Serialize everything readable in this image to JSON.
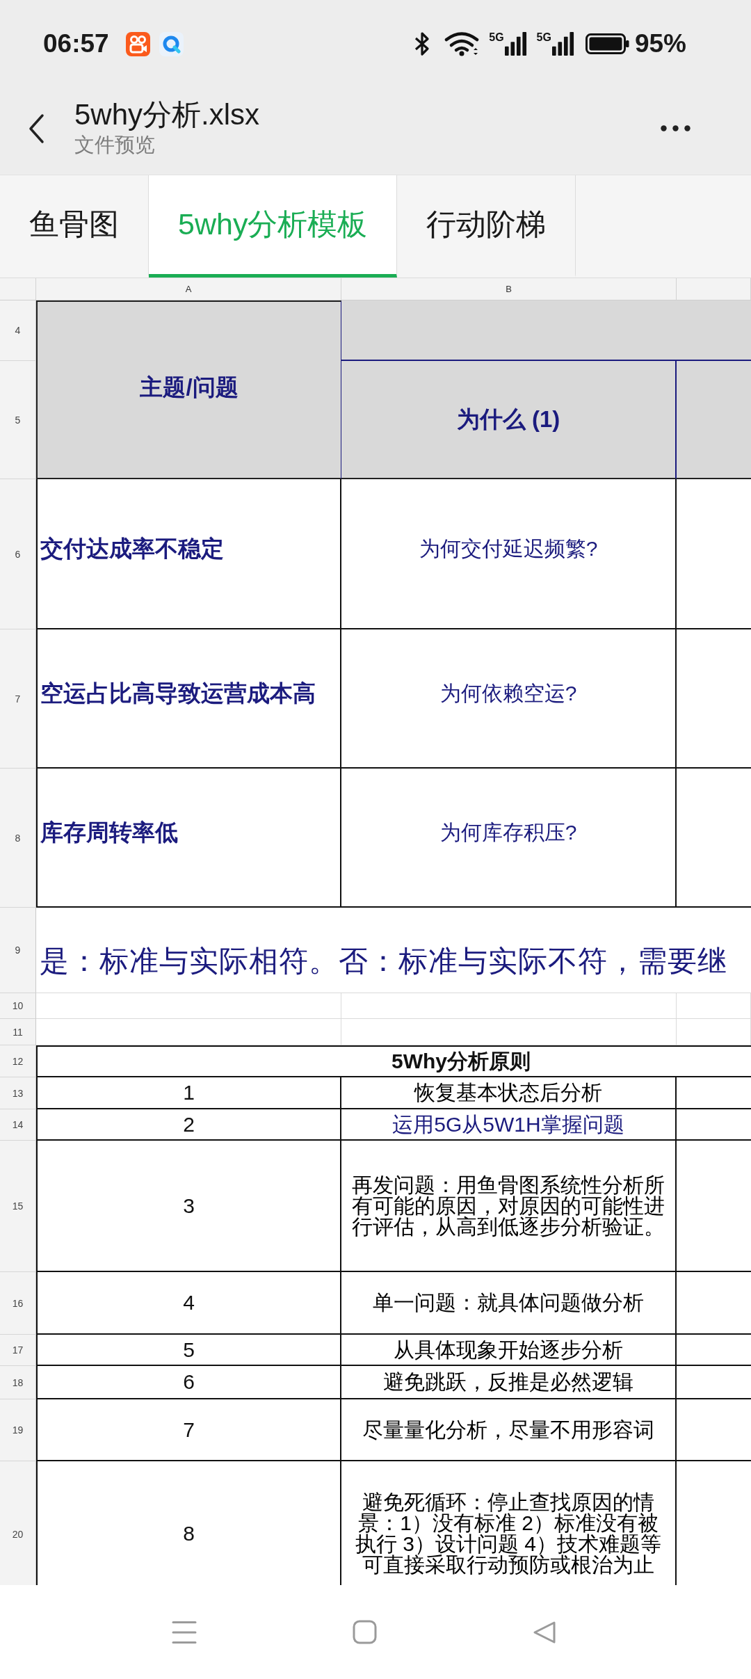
{
  "status_bar": {
    "time": "06:57",
    "networks": [
      "5G",
      "5G"
    ],
    "battery": "95%"
  },
  "header": {
    "title": "5why分析.xlsx",
    "subtitle": "文件预览"
  },
  "sheet_tabs": [
    {
      "label": "鱼骨图",
      "selected": false
    },
    {
      "label": "5why分析模板",
      "selected": true
    },
    {
      "label": "行动阶梯",
      "selected": false
    }
  ],
  "column_headers": [
    "A",
    "B"
  ],
  "header_rows": {
    "numbers": [
      "4",
      "5"
    ],
    "topic": "主题/问题",
    "why": "为什么 (1)"
  },
  "rows": [
    {
      "kind": "question",
      "number": "6",
      "problem": "交付达成率不稳定",
      "why": "为何交付延迟频繁?"
    },
    {
      "kind": "question",
      "number": "7",
      "problem": "空运占比高导致运营成本高",
      "why": "为何依赖空运?"
    },
    {
      "kind": "question",
      "number": "8",
      "problem": "库存周转率低",
      "why": "为何库存积压?"
    },
    {
      "kind": "note",
      "number": "9",
      "text": "是：标准与实际相符。否：标准与实际不符，需要继"
    },
    {
      "kind": "blank",
      "number": "10"
    },
    {
      "kind": "blank",
      "number": "11"
    },
    {
      "kind": "section",
      "number": "12",
      "text": "5Why分析原则"
    },
    {
      "kind": "principle",
      "number": "13",
      "index": "1",
      "text": "恢复基本状态后分析",
      "color": "#000000"
    },
    {
      "kind": "principle",
      "number": "14",
      "index": "2",
      "text": "运用5G从5W1H掌握问题",
      "color": "#1b1b7e"
    },
    {
      "kind": "principle",
      "number": "15",
      "index": "3",
      "text": "再发问题：用鱼骨图系统性分析所有可能的原因，对原因的可能性进行评估，从高到低逐步分析验证。",
      "color": "#000000"
    },
    {
      "kind": "principle",
      "number": "16",
      "index": "4",
      "text": "单一问题：就具体问题做分析",
      "color": "#000000"
    },
    {
      "kind": "principle",
      "number": "17",
      "index": "5",
      "text": "从具体现象开始逐步分析",
      "color": "#000000"
    },
    {
      "kind": "principle",
      "number": "18",
      "index": "6",
      "text": "避免跳跃，反推是必然逻辑",
      "color": "#000000"
    },
    {
      "kind": "principle",
      "number": "19",
      "index": "7",
      "text": "尽量量化分析，尽量不用形容词",
      "color": "#000000"
    },
    {
      "kind": "principle",
      "number": "20",
      "index": "8",
      "text": "避免死循环：停止查找原因的情景：1）没有标准 2）标准没有被执行 3）设计问题 4）技术难题等可直接采取行动预防或根治为止",
      "color": "#000000"
    }
  ]
}
